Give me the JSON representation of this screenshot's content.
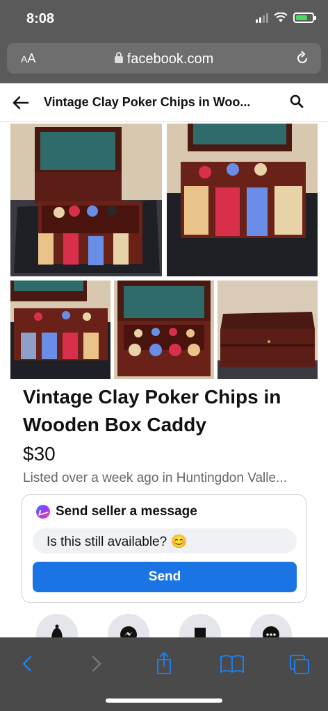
{
  "status": {
    "time": "8:08"
  },
  "browser": {
    "aa_label_big": "A",
    "aa_label_small": "A",
    "url": "facebook.com"
  },
  "header": {
    "title": "Vintage Clay Poker Chips in Woo..."
  },
  "listing": {
    "title": "Vintage Clay Poker Chips in Wooden Box Caddy",
    "price": "$30",
    "listed": "Listed over a week ago in Huntingdon Valle..."
  },
  "message": {
    "heading": "Send seller a message",
    "input_value": "Is this still available? 😊",
    "send_label": "Send"
  },
  "colors": {
    "accent": "#1b74e4",
    "toolbar_icon": "#1e7ef0",
    "wood": "#5a1e16",
    "felt": "#2f6b6b"
  }
}
